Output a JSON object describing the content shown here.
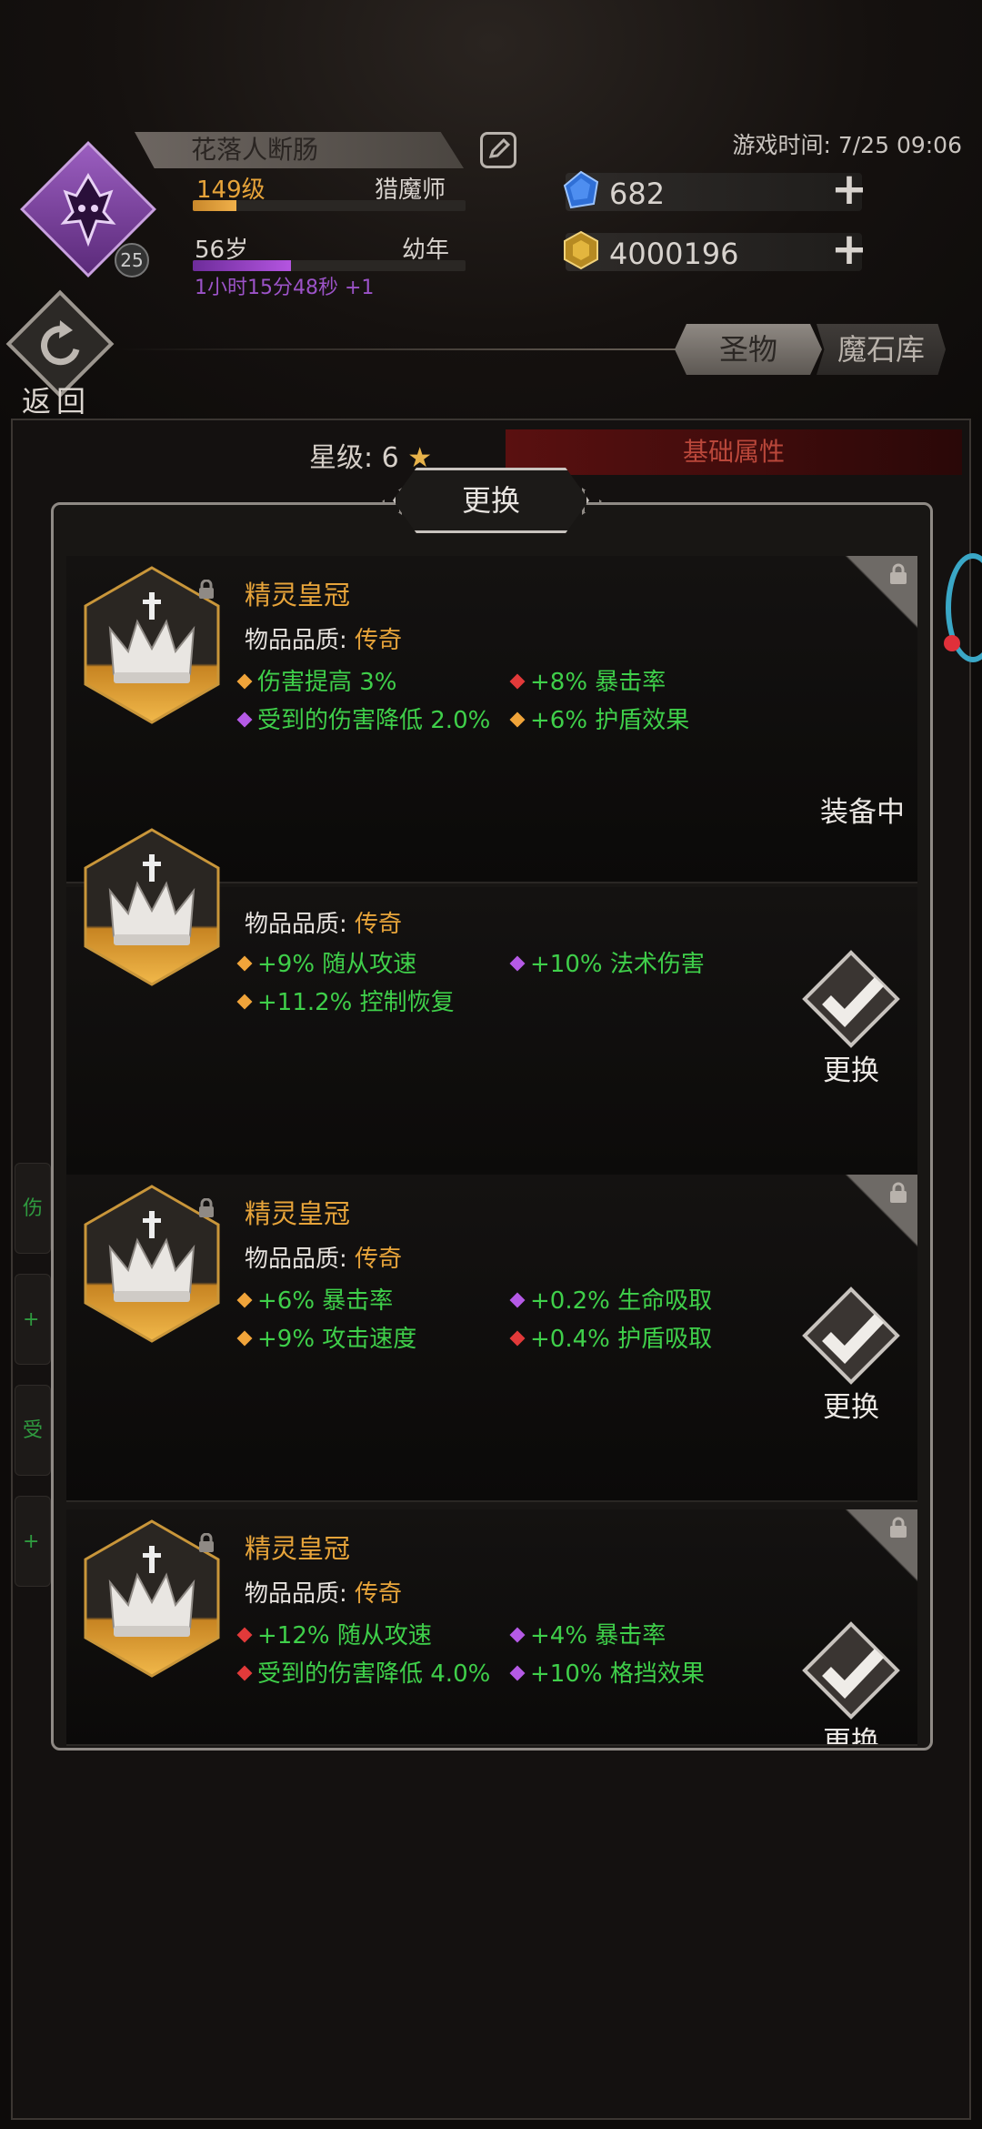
{
  "header": {
    "player_name": "花落人断肠",
    "avatar_level": "25",
    "level": "149级",
    "class": "猎魔师",
    "level_progress": 0.16,
    "age": "56岁",
    "age_stage": "幼年",
    "age_progress": 0.36,
    "age_timer": "1小时15分48秒 +1",
    "game_time": "游戏时间: 7/25 09:06",
    "gems": "682",
    "gold": "4000196"
  },
  "nav": {
    "back_label": "返回",
    "tabs": [
      {
        "label": "圣物",
        "active": true
      },
      {
        "label": "魔石库",
        "active": false
      }
    ]
  },
  "background_panel": {
    "star_label": "星级: 6",
    "basic_attr_label": "基础属性",
    "side_strip_text": [
      "伤",
      "+",
      "受",
      "+"
    ]
  },
  "modal": {
    "title": "更换",
    "items": [
      {
        "name": "精灵皇冠",
        "quality_label": "物品品质:",
        "quality": "传奇",
        "attrs_left": [
          {
            "text": "伤害提高 3%",
            "gem": "orange"
          },
          {
            "text": "受到的伤害降低 2.0%",
            "gem": "purple"
          }
        ],
        "attrs_right": [
          {
            "text": "+8% 暴击率",
            "gem": "red"
          },
          {
            "text": "+6% 护盾效果",
            "gem": "orange"
          }
        ],
        "status": "装备中"
      },
      {
        "name": "",
        "quality_label": "物品品质:",
        "quality": "传奇",
        "attrs_left": [
          {
            "text": "+9% 随从攻速",
            "gem": "orange"
          },
          {
            "text": "+11.2% 控制恢复",
            "gem": "orange"
          }
        ],
        "attrs_right": [
          {
            "text": "+10% 法术伤害",
            "gem": "purple"
          }
        ],
        "action": "更换"
      },
      {
        "name": "精灵皇冠",
        "quality_label": "物品品质:",
        "quality": "传奇",
        "attrs_left": [
          {
            "text": "+6% 暴击率",
            "gem": "orange"
          },
          {
            "text": "+9% 攻击速度",
            "gem": "orange"
          }
        ],
        "attrs_right": [
          {
            "text": "+0.2% 生命吸取",
            "gem": "purple"
          },
          {
            "text": "+0.4% 护盾吸取",
            "gem": "red"
          }
        ],
        "action": "更换"
      },
      {
        "name": "精灵皇冠",
        "quality_label": "物品品质:",
        "quality": "传奇",
        "attrs_left": [
          {
            "text": "+12% 随从攻速",
            "gem": "red"
          },
          {
            "text": "受到的伤害降低 4.0%",
            "gem": "red"
          }
        ],
        "attrs_right": [
          {
            "text": "+4% 暴击率",
            "gem": "purple"
          },
          {
            "text": "+10% 格挡效果",
            "gem": "purple"
          }
        ],
        "action": "更换"
      }
    ]
  },
  "colors": {
    "gem_orange": "#f0a43a",
    "gem_red": "#e23a3a",
    "gem_purple": "#b55ae6",
    "attr_green": "#3fcf4a",
    "legend_gold": "#e7a43a"
  }
}
